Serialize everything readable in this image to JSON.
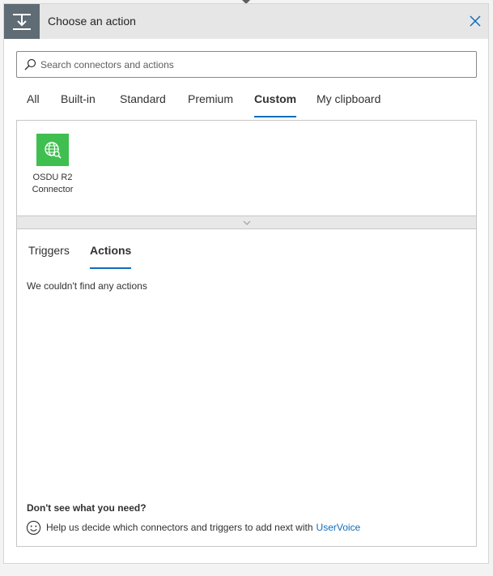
{
  "header": {
    "title": "Choose an action",
    "icon": "insert-action-icon",
    "close_icon": "close-icon"
  },
  "search": {
    "placeholder": "Search connectors and actions",
    "value": ""
  },
  "tabs": [
    {
      "label": "All",
      "active": false
    },
    {
      "label": "Built-in",
      "active": false
    },
    {
      "label": "Standard",
      "active": false
    },
    {
      "label": "Premium",
      "active": false
    },
    {
      "label": "Custom",
      "active": true
    },
    {
      "label": "My clipboard",
      "active": false
    }
  ],
  "connectors": [
    {
      "name_line1": "OSDU R2",
      "name_line2": "Connector",
      "icon": "globe-search-icon",
      "color": "#3fbf4f"
    }
  ],
  "subtabs": [
    {
      "label": "Triggers",
      "active": false
    },
    {
      "label": "Actions",
      "active": true
    }
  ],
  "empty_message": "We couldn't find any actions",
  "help": {
    "title": "Don't see what you need?",
    "text": "Help us decide which connectors and triggers to add next with",
    "link": "UserVoice"
  },
  "colors": {
    "accent": "#0f6cbd",
    "header_bg": "#e6e6e6",
    "header_icon_bg": "#5f6b75",
    "connector_green": "#3fbf4f"
  }
}
